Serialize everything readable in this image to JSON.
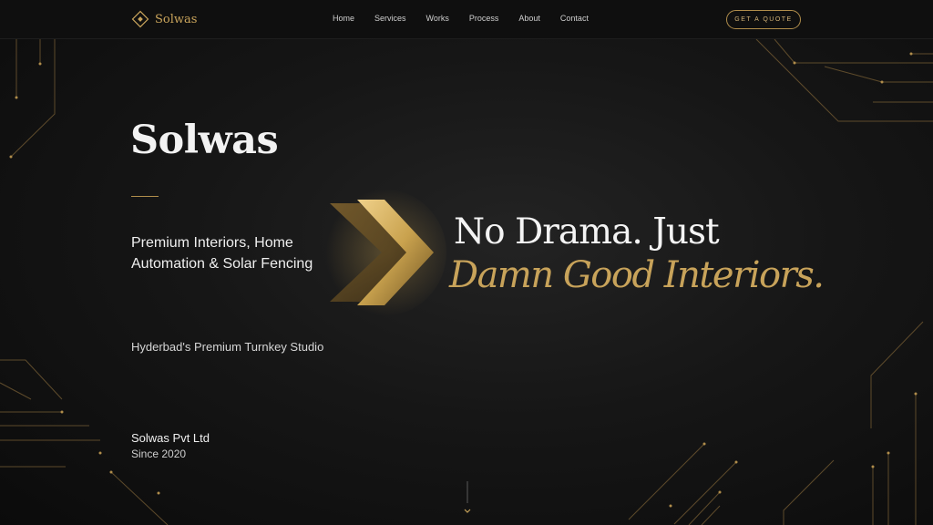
{
  "nav": {
    "brand": "Solwas",
    "links": [
      "Home",
      "Services",
      "Works",
      "Process",
      "About",
      "Contact"
    ],
    "cta": "GET A QUOTE"
  },
  "hero": {
    "title": "Solwas",
    "subtitle": "Premium Interiors, Home Automation & Solar Fencing",
    "tagline": "Hyderbad's Premium Turnkey Studio",
    "company": "Solwas Pvt Ltd",
    "since": "Since 2020",
    "headline_line1": "No Drama. Just",
    "headline_line2": "Damn Good Interiors."
  },
  "icons": {
    "brand": "diamond-logo-icon",
    "arrow": "double-chevron-right-icon",
    "scroll": "chevron-down-icon"
  },
  "colors": {
    "accent": "#c8a35a",
    "background": "#141414",
    "nav_background": "#0f0f0f"
  }
}
